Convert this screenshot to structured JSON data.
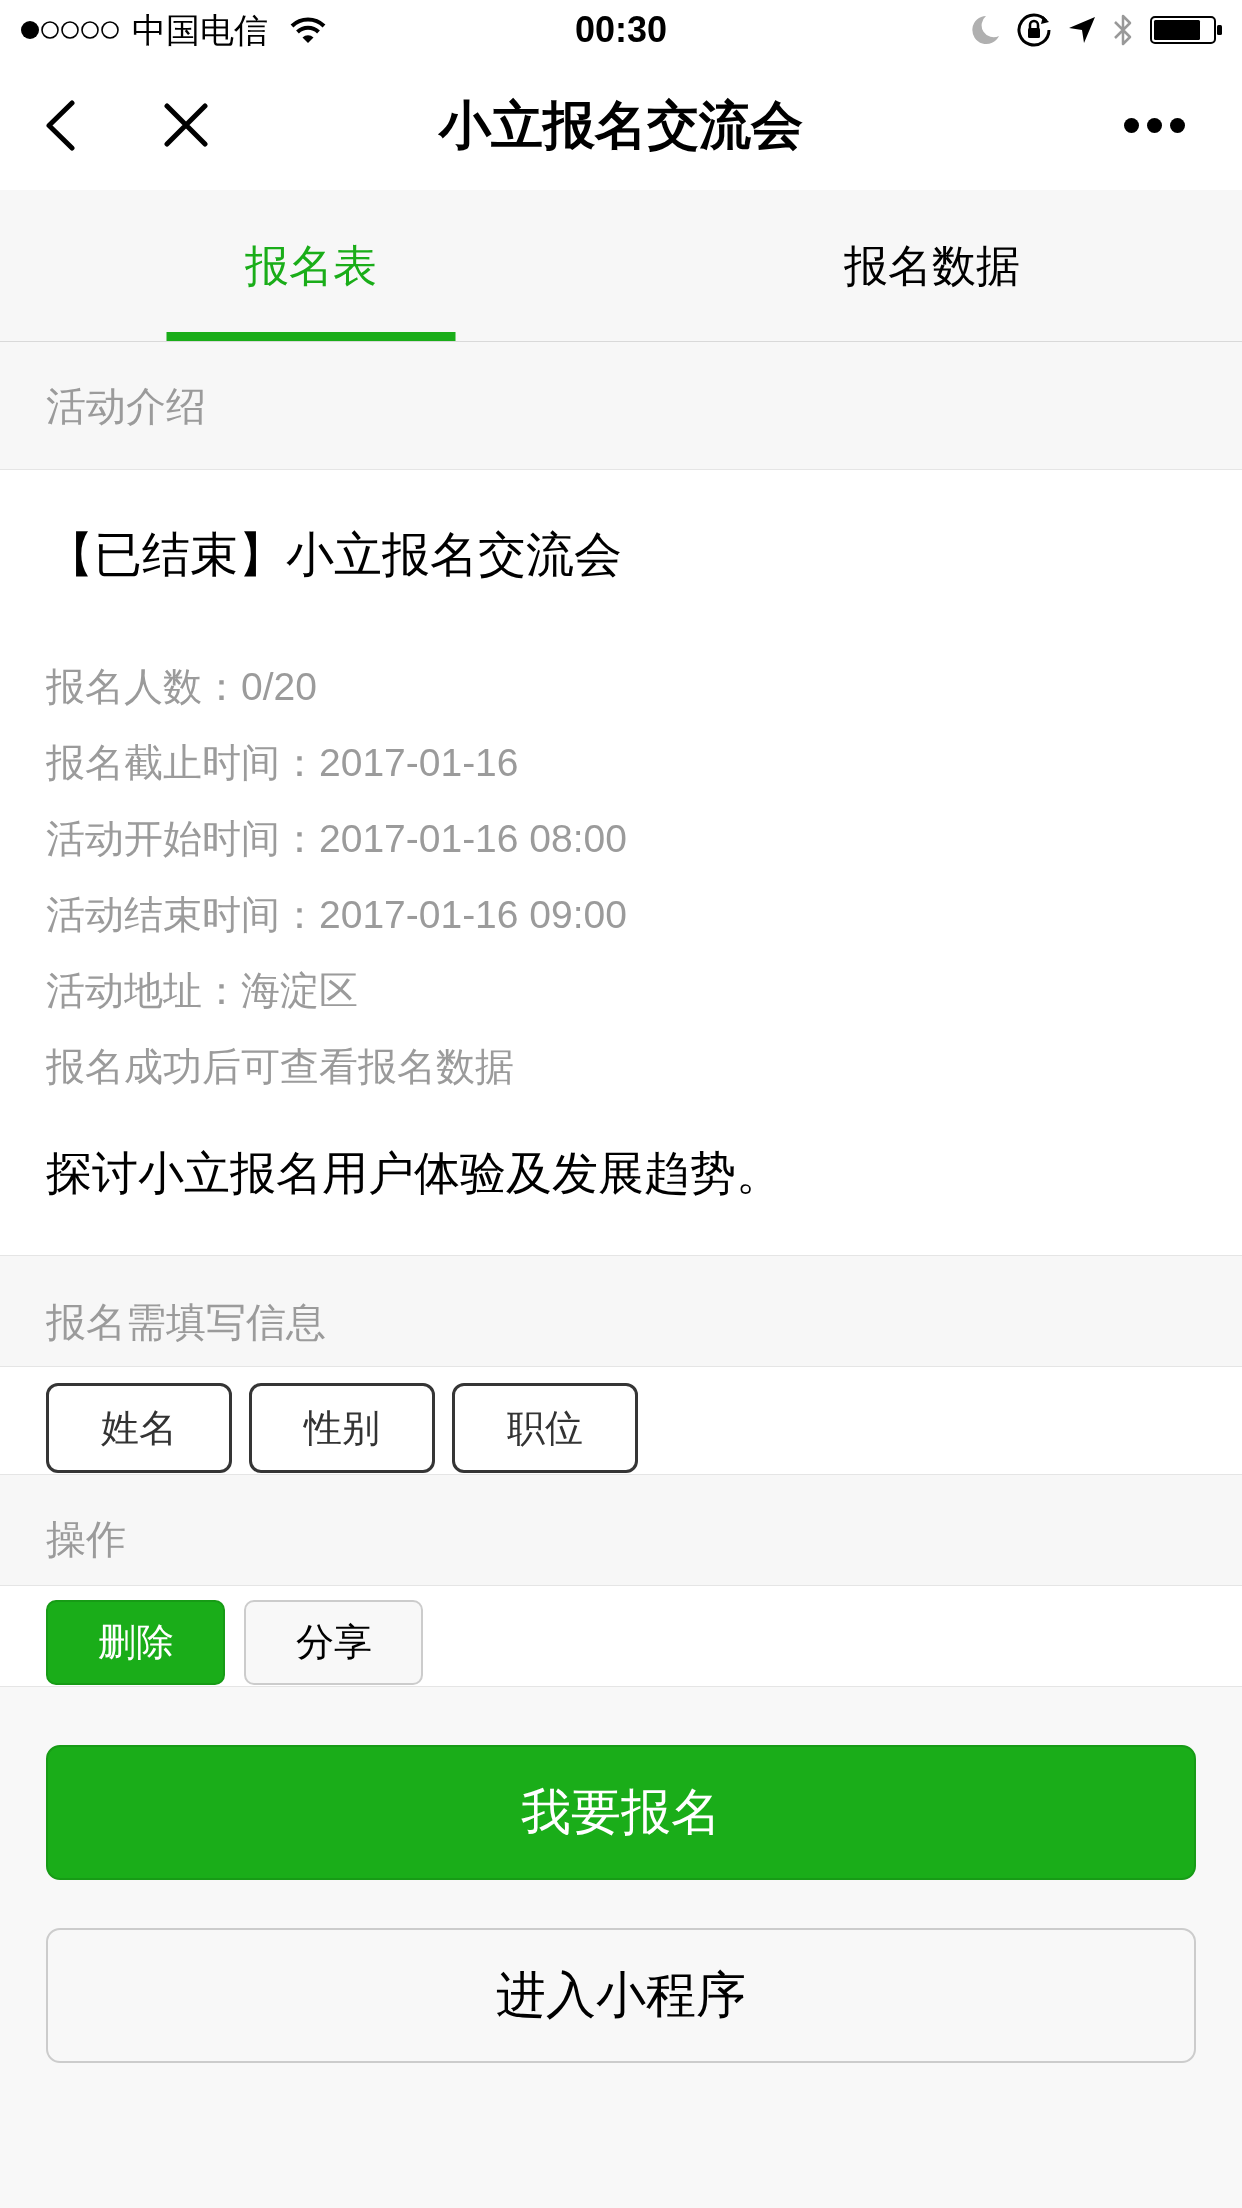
{
  "status_bar": {
    "carrier": "中国电信",
    "time": "00:30"
  },
  "nav_bar": {
    "title": "小立报名交流会"
  },
  "tabs": [
    {
      "label": "报名表",
      "selected": true
    },
    {
      "label": "报名数据",
      "selected": false
    }
  ],
  "intro": {
    "header": "活动介绍",
    "title": "【已结束】小立报名交流会",
    "details": [
      "报名人数：0/20",
      "报名截止时间：2017-01-16",
      "活动开始时间：2017-01-16 08:00",
      "活动结束时间：2017-01-16 09:00",
      "活动地址：海淀区",
      "报名成功后可查看报名数据"
    ],
    "description": "探讨小立报名用户体验及发展趋势。"
  },
  "required_info": {
    "header": "报名需填写信息",
    "fields": [
      "姓名",
      "性别",
      "职位"
    ]
  },
  "actions": {
    "header": "操作",
    "buttons": [
      {
        "label": "删除",
        "kind": "primary"
      },
      {
        "label": "分享",
        "kind": "default"
      }
    ]
  },
  "footer_buttons": [
    {
      "label": "我要报名",
      "kind": "primary"
    },
    {
      "label": "进入小程序",
      "kind": "default"
    }
  ]
}
